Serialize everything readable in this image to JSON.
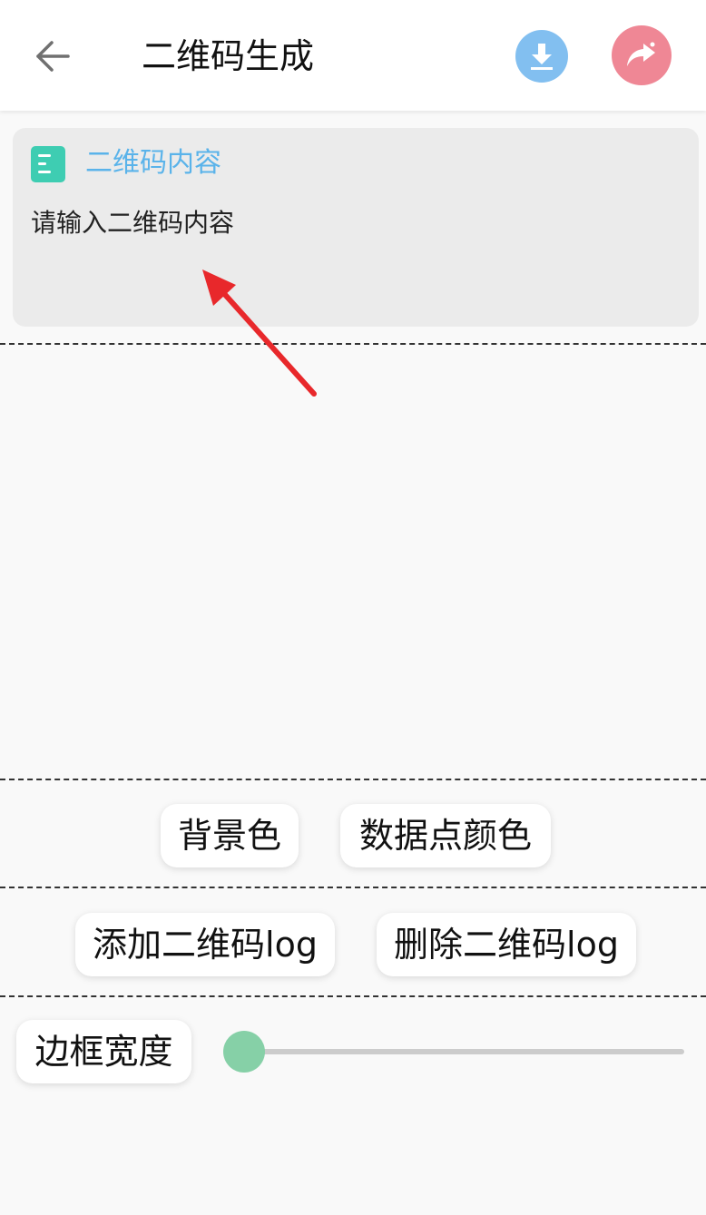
{
  "header": {
    "title": "二维码生成",
    "back_icon": "back-arrow-icon",
    "download_icon": "download-icon",
    "share_icon": "share-icon"
  },
  "content_card": {
    "label": "二维码内容",
    "icon": "document-icon",
    "input_value": "",
    "input_placeholder": "请输入二维码内容"
  },
  "color_buttons": {
    "background_color": "背景色",
    "data_point_color": "数据点颜色"
  },
  "logo_buttons": {
    "add_logo": "添加二维码log",
    "remove_logo": "删除二维码log"
  },
  "border": {
    "label": "边框宽度",
    "slider_value": 0
  },
  "colors": {
    "accent_blue": "#5ab3ea",
    "download_blue": "#82bff0",
    "share_pink": "#ef8795",
    "teal_icon": "#3ecdb2",
    "slider_thumb": "#86d0a7",
    "annotation_red": "#e8282b"
  }
}
